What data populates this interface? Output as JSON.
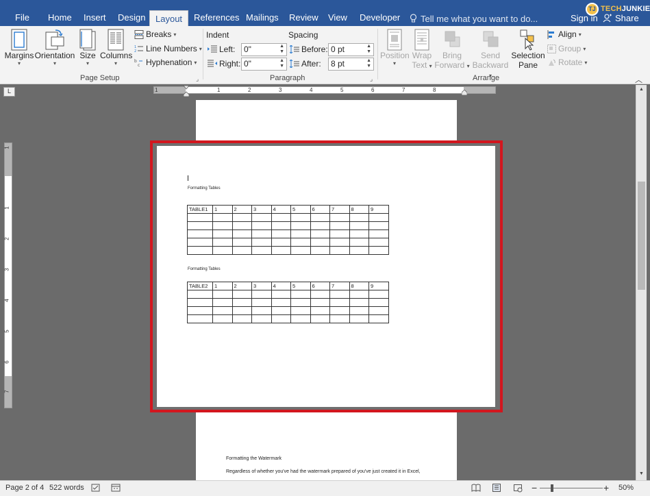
{
  "tabs": [
    {
      "label": "File",
      "active": false
    },
    {
      "label": "Home",
      "active": false
    },
    {
      "label": "Insert",
      "active": false
    },
    {
      "label": "Design",
      "active": false
    },
    {
      "label": "Layout",
      "active": true
    },
    {
      "label": "References",
      "active": false
    },
    {
      "label": "Mailings",
      "active": false
    },
    {
      "label": "Review",
      "active": false
    },
    {
      "label": "View",
      "active": false
    },
    {
      "label": "Developer",
      "active": false
    }
  ],
  "tell_me": "Tell me what you want to do...",
  "sign_in": "Sign in",
  "share": "Share",
  "logo": {
    "badge": "TJ",
    "part1": "TECH",
    "part2": "JUNKIE"
  },
  "page_setup": {
    "margins": "Margins",
    "orientation": "Orientation",
    "size": "Size",
    "columns": "Columns",
    "breaks": "Breaks",
    "line_numbers": "Line Numbers",
    "hyphenation": "Hyphenation",
    "group_label": "Page Setup"
  },
  "paragraph": {
    "indent_label": "Indent",
    "spacing_label": "Spacing",
    "left_label": "Left:",
    "left_value": "0\"",
    "right_label": "Right:",
    "right_value": "0\"",
    "before_label": "Before:",
    "before_value": "0 pt",
    "after_label": "After:",
    "after_value": "8 pt",
    "group_label": "Paragraph"
  },
  "arrange": {
    "position": "Position",
    "wrap_text_1": "Wrap",
    "wrap_text_2": "Text",
    "bring_forward_1": "Bring",
    "bring_forward_2": "Forward",
    "send_backward_1": "Send",
    "send_backward_2": "Backward",
    "selection_pane_1": "Selection",
    "selection_pane_2": "Pane",
    "align": "Align",
    "group": "Group",
    "rotate": "Rotate",
    "group_label": "Arrange"
  },
  "ruler": {
    "h_numbers": [
      "1",
      "1",
      "2",
      "3",
      "4",
      "5",
      "6",
      "7",
      "8"
    ],
    "v_numbers": [
      "1",
      "1",
      "2",
      "3",
      "4",
      "5",
      "6",
      "7"
    ],
    "tab_selector": "L"
  },
  "document": {
    "caption1": "Formatting Tables",
    "caption2": "Formatting Tables",
    "table1_header": [
      "TABLE1",
      "1",
      "2",
      "3",
      "4",
      "5",
      "6",
      "7",
      "8",
      "9"
    ],
    "table2_header": [
      "TABLE2",
      "1",
      "2",
      "3",
      "4",
      "5",
      "6",
      "7",
      "8",
      "9"
    ],
    "below_heading": "Formatting the Watermark",
    "below_text": "Regardless of whether you've had the watermark prepared of you've just created it in Excel,"
  },
  "status": {
    "page": "Page 2 of 4",
    "words": "522 words",
    "zoom": "50%"
  },
  "colors": {
    "accent": "#2b579a",
    "highlight": "#d2161e"
  }
}
